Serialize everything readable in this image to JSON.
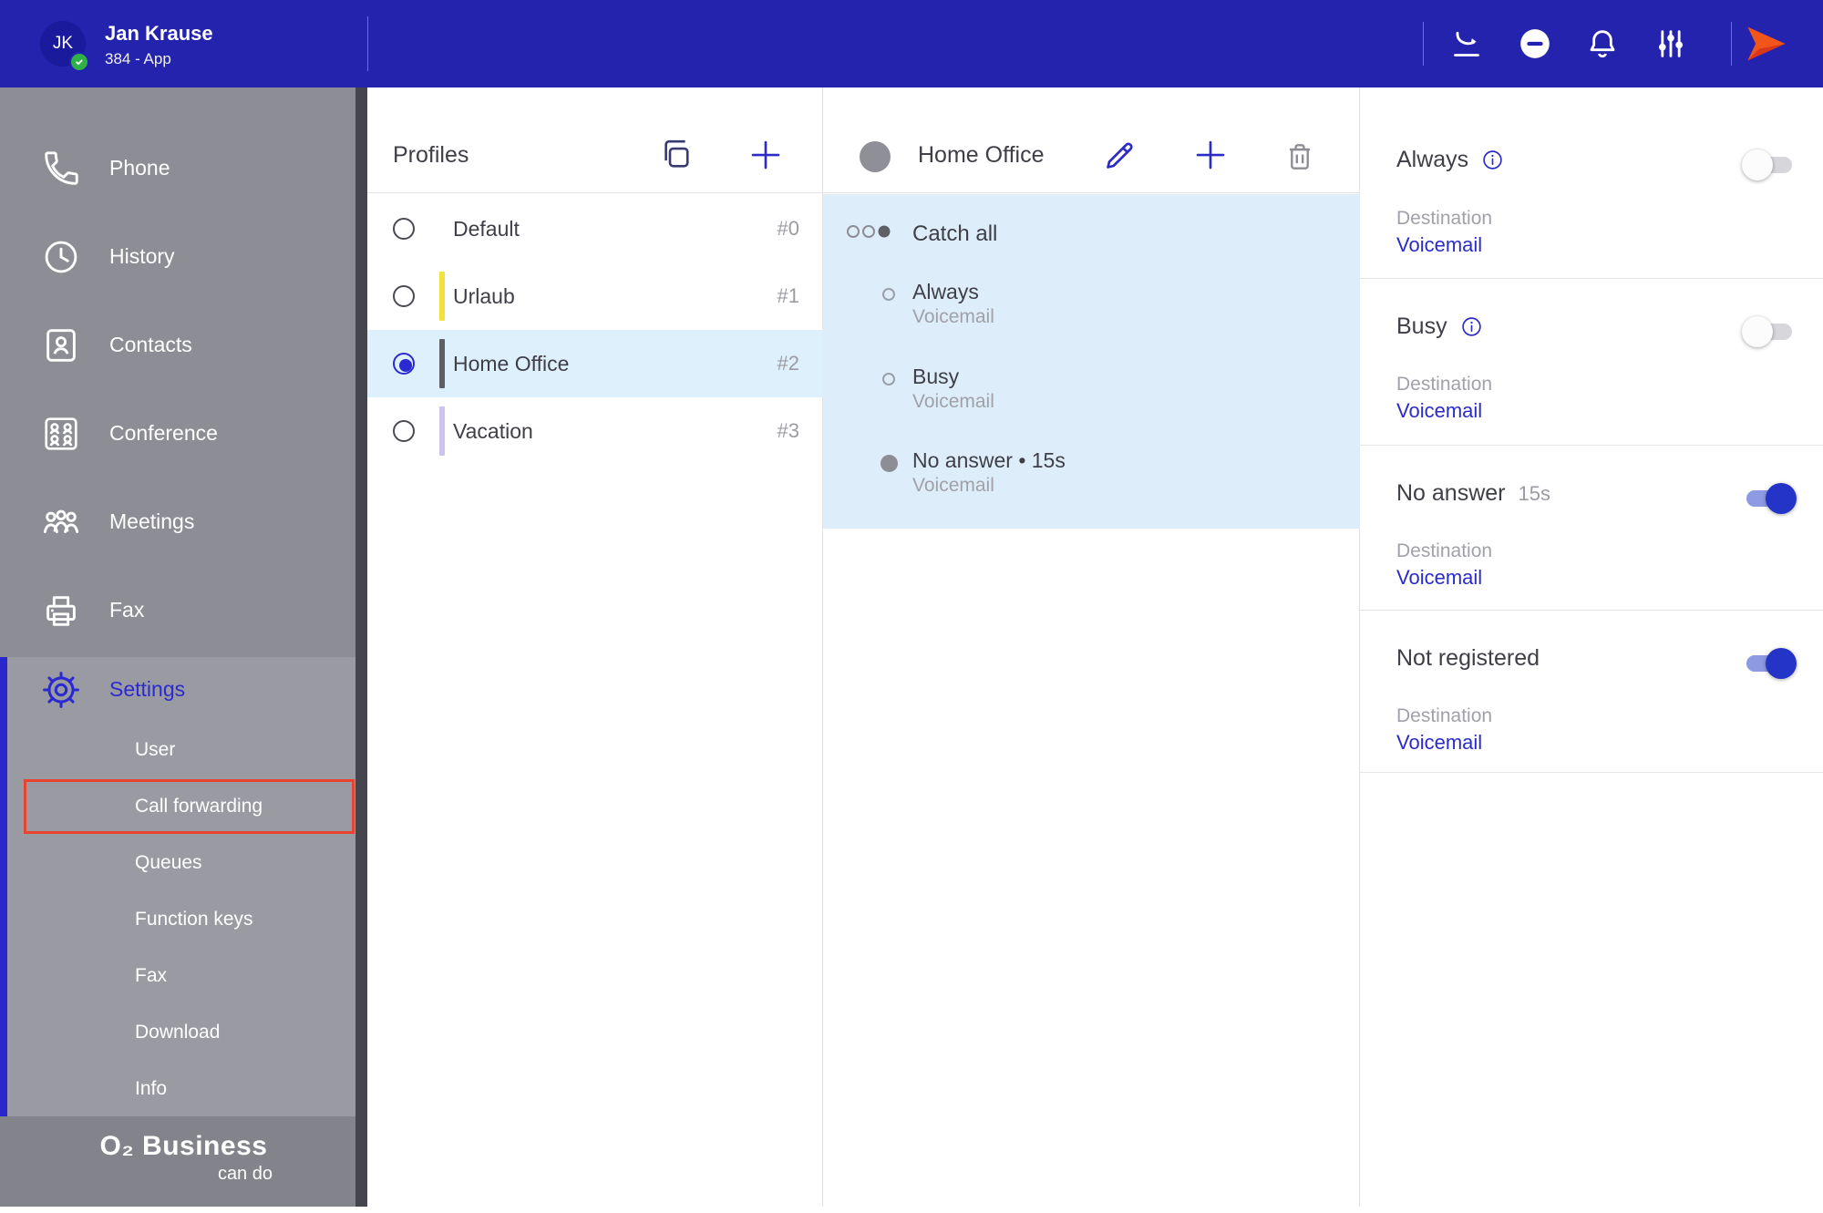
{
  "topbar": {
    "avatar_initials": "JK",
    "user_name": "Jan Krause",
    "user_subtitle": "384 - App"
  },
  "sidebar": {
    "items": [
      {
        "label": "Phone",
        "icon": "phone-icon"
      },
      {
        "label": "History",
        "icon": "history-icon"
      },
      {
        "label": "Contacts",
        "icon": "contacts-icon"
      },
      {
        "label": "Conference",
        "icon": "conference-icon"
      },
      {
        "label": "Meetings",
        "icon": "meetings-icon"
      },
      {
        "label": "Fax",
        "icon": "fax-icon"
      }
    ],
    "settings": {
      "label": "Settings",
      "icon": "gear-icon",
      "subitems": [
        {
          "label": "User",
          "highlighted": false
        },
        {
          "label": "Call forwarding",
          "highlighted": true
        },
        {
          "label": "Queues",
          "highlighted": false
        },
        {
          "label": "Function keys",
          "highlighted": false
        },
        {
          "label": "Fax",
          "highlighted": false
        },
        {
          "label": "Download",
          "highlighted": false
        },
        {
          "label": "Info",
          "highlighted": false
        }
      ]
    },
    "logo": {
      "line1": "O₂ Business",
      "line2": "can do"
    }
  },
  "profiles": {
    "title": "Profiles",
    "items": [
      {
        "name": "Default",
        "number": "#0",
        "color": "",
        "selected": false
      },
      {
        "name": "Urlaub",
        "number": "#1",
        "color": "#f3e23c",
        "selected": false
      },
      {
        "name": "Home Office",
        "number": "#2",
        "color": "#5c6066",
        "selected": true
      },
      {
        "name": "Vacation",
        "number": "#3",
        "color": "#cdc3ee",
        "selected": false
      }
    ]
  },
  "profile_detail": {
    "title": "Home Office",
    "catch_all_label": "Catch all",
    "rules": [
      {
        "title": "Always",
        "destination": "Voicemail"
      },
      {
        "title": "Busy",
        "destination": "Voicemail"
      },
      {
        "title": "No answer • 15s",
        "destination": "Voicemail"
      }
    ]
  },
  "forwarding": {
    "sections": [
      {
        "title": "Always",
        "timeout": "",
        "has_info": true,
        "enabled": false,
        "destination_label": "Destination",
        "destination": "Voicemail"
      },
      {
        "title": "Busy",
        "timeout": "",
        "has_info": true,
        "enabled": false,
        "destination_label": "Destination",
        "destination": "Voicemail"
      },
      {
        "title": "No answer",
        "timeout": "15s",
        "has_info": false,
        "enabled": true,
        "destination_label": "Destination",
        "destination": "Voicemail"
      },
      {
        "title": "Not registered",
        "timeout": "",
        "has_info": false,
        "enabled": true,
        "destination_label": "Destination",
        "destination": "Voicemail"
      }
    ]
  },
  "icons": {
    "topbar": [
      "call-pull-icon",
      "do-not-disturb-icon",
      "bell-icon",
      "sliders-icon",
      "brand-send-icon"
    ],
    "profiles_header": [
      "copy-icon",
      "plus-icon"
    ],
    "detail_header": [
      "pencil-icon",
      "plus-icon",
      "trash-icon"
    ]
  },
  "colors": {
    "topbar_blue": "#2323ae",
    "accent_blue": "#2b2bc8",
    "toggle_on": "#2434c6",
    "selected_row": "#def0fb",
    "rules_panel": "#ddeefa",
    "highlight_red": "#e8432f",
    "brand_orange": "#f2551c",
    "sidebar_gray": "#8d8d95"
  }
}
